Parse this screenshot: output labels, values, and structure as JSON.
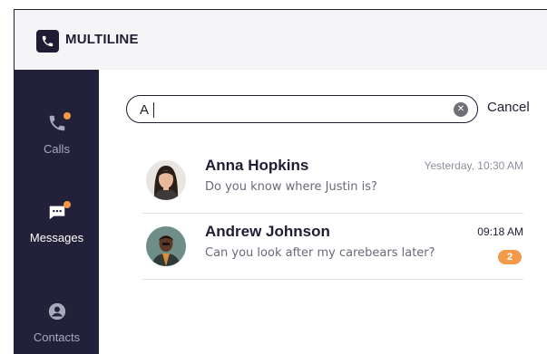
{
  "app": {
    "title": "MULTILINE"
  },
  "sidebar": {
    "items": [
      {
        "label": "Calls",
        "icon": "phone-icon",
        "active": false,
        "has_dot": true
      },
      {
        "label": "Messages",
        "icon": "message-icon",
        "active": true,
        "has_dot": true
      },
      {
        "label": "Contacts",
        "icon": "user-icon",
        "active": false,
        "has_dot": false
      }
    ]
  },
  "search": {
    "value": "A",
    "clear_icon": "close-icon"
  },
  "cancel_label": "Cancel",
  "conversations": [
    {
      "name": "Anna Hopkins",
      "message": "Do you know where Justin is?",
      "time": "Yesterday, 10:30 AM",
      "unread": null
    },
    {
      "name": "Andrew Johnson",
      "message": "Can you look after my carebears later?",
      "time": "09:18 AM",
      "unread": "2"
    }
  ],
  "colors": {
    "navy": "#1f1d33",
    "sidebar": "#23213a",
    "accent": "#f2994a"
  }
}
